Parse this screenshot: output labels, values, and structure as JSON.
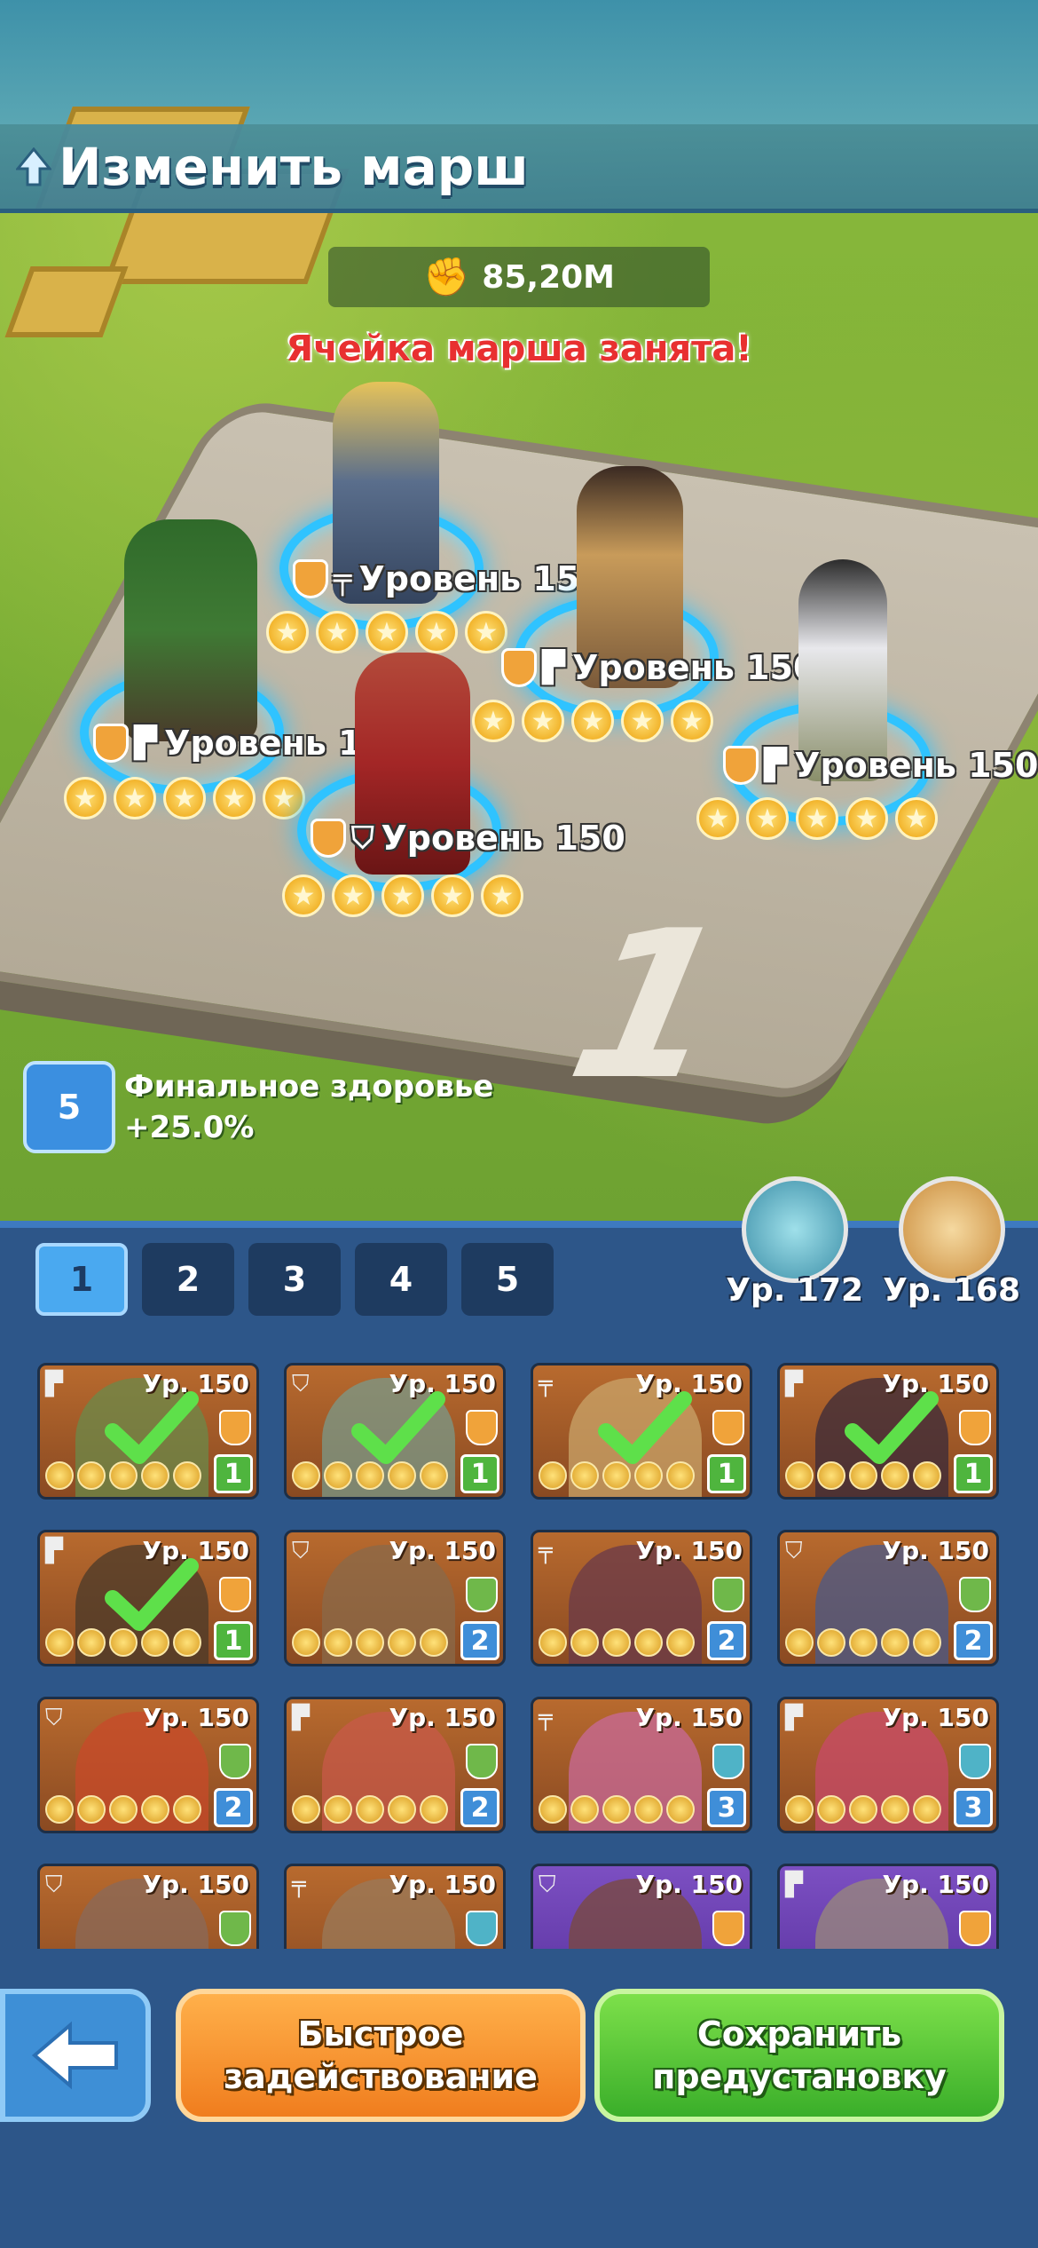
{
  "header": {
    "title": "Изменить марш"
  },
  "march": {
    "power": "85,20M",
    "warning": "Ячейка марша занята!",
    "plate_number": "1"
  },
  "heroes_on_field": [
    {
      "label": "Уровень 150",
      "weapon": "rifle-icon",
      "stars": 5
    },
    {
      "label": "Уровень 150",
      "weapon": "pistol-icon",
      "stars": 5
    },
    {
      "label": "Уровень 150",
      "weapon": "pistol-icon",
      "stars": 5
    },
    {
      "label": "Уровень 150",
      "weapon": "shield-icon",
      "stars": 5
    },
    {
      "label": "Уровень 150",
      "weapon": "pistol-icon",
      "stars": 5
    }
  ],
  "bonus": {
    "badge": "5",
    "line1": "Финальное здоровье",
    "line2": "+25.0%"
  },
  "pets": [
    {
      "level": "Ур. 172",
      "color": "#5fb7c9"
    },
    {
      "level": "Ур. 168",
      "color": "#d89a4a"
    }
  ],
  "preset_tabs": [
    "1",
    "2",
    "3",
    "4",
    "5"
  ],
  "active_tab": "1",
  "roster": [
    {
      "level": "Ур. 150",
      "count": "1",
      "selected": true,
      "type": "pistol",
      "badge": "orange",
      "tint": "orange"
    },
    {
      "level": "Ур. 150",
      "count": "1",
      "selected": true,
      "type": "shield",
      "badge": "orange",
      "tint": "orange"
    },
    {
      "level": "Ур. 150",
      "count": "1",
      "selected": true,
      "type": "rifle",
      "badge": "orange",
      "tint": "orange"
    },
    {
      "level": "Ур. 150",
      "count": "1",
      "selected": true,
      "type": "pistol",
      "badge": "orange",
      "tint": "orange"
    },
    {
      "level": "Ур. 150",
      "count": "1",
      "selected": true,
      "type": "pistol",
      "badge": "orange",
      "tint": "orange"
    },
    {
      "level": "Ур. 150",
      "count": "2",
      "selected": false,
      "type": "shield",
      "badge": "green",
      "tint": "orange"
    },
    {
      "level": "Ур. 150",
      "count": "2",
      "selected": false,
      "type": "rifle",
      "badge": "green",
      "tint": "orange"
    },
    {
      "level": "Ур. 150",
      "count": "2",
      "selected": false,
      "type": "shield",
      "badge": "green",
      "tint": "orange"
    },
    {
      "level": "Ур. 150",
      "count": "2",
      "selected": false,
      "type": "shield",
      "badge": "green",
      "tint": "orange"
    },
    {
      "level": "Ур. 150",
      "count": "2",
      "selected": false,
      "type": "pistol",
      "badge": "green",
      "tint": "orange"
    },
    {
      "level": "Ур. 150",
      "count": "3",
      "selected": false,
      "type": "rifle",
      "badge": "teal",
      "tint": "orange"
    },
    {
      "level": "Ур. 150",
      "count": "3",
      "selected": false,
      "type": "pistol",
      "badge": "teal",
      "tint": "orange"
    },
    {
      "level": "Ур. 150",
      "count": "",
      "selected": false,
      "type": "shield",
      "badge": "green",
      "tint": "orange"
    },
    {
      "level": "Ур. 150",
      "count": "",
      "selected": false,
      "type": "rifle",
      "badge": "teal",
      "tint": "orange"
    },
    {
      "level": "Ур. 150",
      "count": "",
      "selected": false,
      "type": "shield",
      "badge": "orange",
      "tint": "purple"
    },
    {
      "level": "Ур. 150",
      "count": "",
      "selected": false,
      "type": "pistol",
      "badge": "orange",
      "tint": "purple"
    }
  ],
  "buttons": {
    "quick_line1": "Быстрое",
    "quick_line2": "задействование",
    "save_line1": "Сохранить",
    "save_line2": "предустановку"
  },
  "colors": {
    "accent_blue": "#3e8fd6",
    "ring": "#2fc3ff",
    "warning": "#e83030"
  }
}
